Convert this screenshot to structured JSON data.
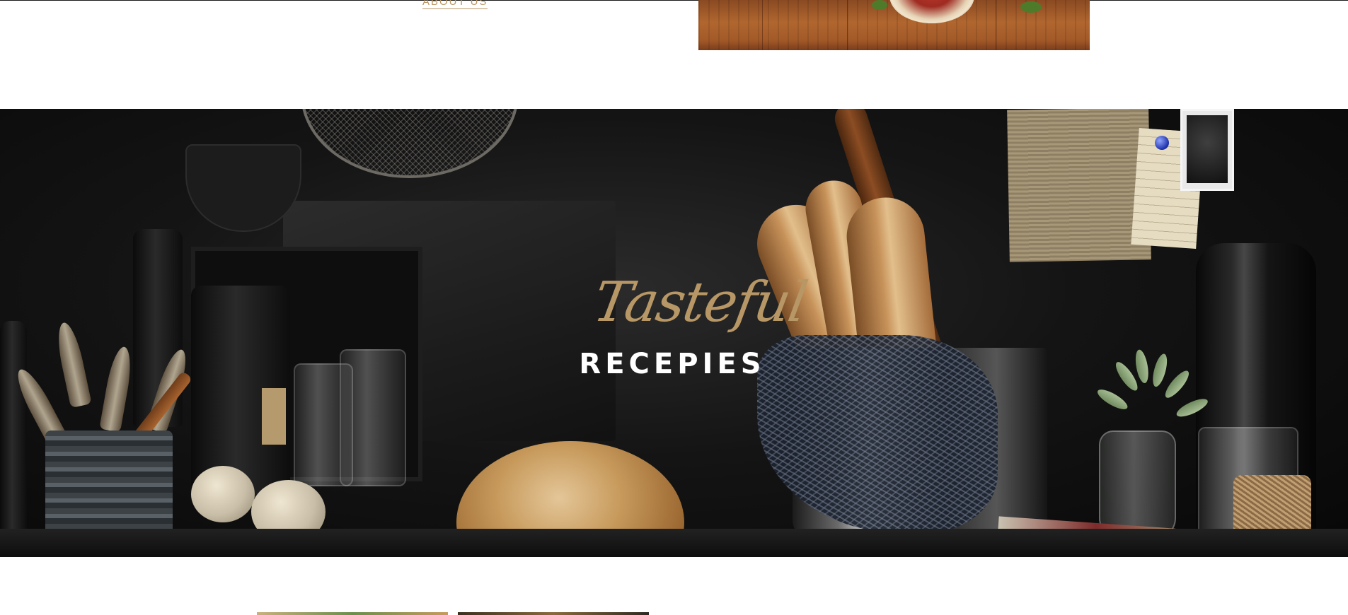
{
  "nav": {
    "about_label": "ABOUT US"
  },
  "hero": {
    "script_title": "Tasteful",
    "block_title": "RECEPIES"
  },
  "colors": {
    "accent": "#b89766",
    "hero_text": "#ffffff",
    "background": "#ffffff"
  }
}
